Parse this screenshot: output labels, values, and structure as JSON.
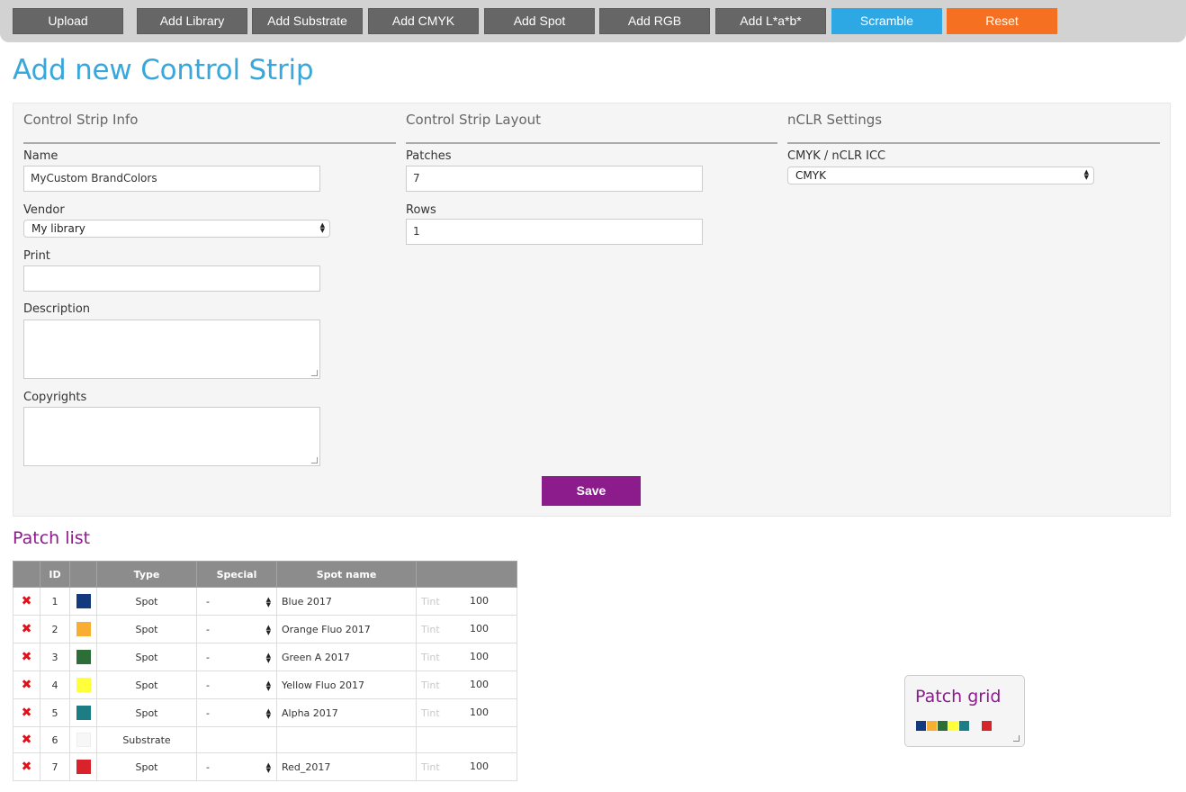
{
  "toolbar": {
    "buttons": [
      "Upload",
      "Add Library",
      "Add Substrate",
      "Add CMYK",
      "Add Spot",
      "Add RGB",
      "Add L*a*b*",
      "Scramble",
      "Reset"
    ],
    "colors": {
      "default": "#666666",
      "scramble": "#2ea8e4",
      "reset": "#f57121"
    }
  },
  "page": {
    "title": "Add new Control Strip"
  },
  "info": {
    "heading": "Control Strip Info",
    "name_label": "Name",
    "name_value": "MyCustom BrandColors",
    "vendor_label": "Vendor",
    "vendor_value": "My library",
    "print_label": "Print",
    "print_value": "",
    "description_label": "Description",
    "copyrights_label": "Copyrights"
  },
  "layout": {
    "heading": "Control Strip Layout",
    "patches_label": "Patches",
    "patches_value": "7",
    "rows_label": "Rows",
    "rows_value": "1"
  },
  "nclr": {
    "heading": "nCLR Settings",
    "icc_label": "CMYK / nCLR ICC",
    "icc_value": "CMYK"
  },
  "save_label": "Save",
  "patch_list": {
    "title": "Patch list",
    "headers": [
      "",
      "ID",
      "",
      "Type",
      "Special",
      "Spot name",
      ""
    ],
    "rows": [
      {
        "id": "1",
        "color": "#123a7c",
        "type": "Spot",
        "special": "-",
        "spot_name": "Blue 2017",
        "tint_label": "Tint",
        "tint": "100"
      },
      {
        "id": "2",
        "color": "#f7ae33",
        "type": "Spot",
        "special": "-",
        "spot_name": "Orange Fluo 2017",
        "tint_label": "Tint",
        "tint": "100"
      },
      {
        "id": "3",
        "color": "#2d6e36",
        "type": "Spot",
        "special": "-",
        "spot_name": "Green A 2017",
        "tint_label": "Tint",
        "tint": "100"
      },
      {
        "id": "4",
        "color": "#ffff3a",
        "type": "Spot",
        "special": "-",
        "spot_name": "Yellow Fluo 2017",
        "tint_label": "Tint",
        "tint": "100"
      },
      {
        "id": "5",
        "color": "#1d7d84",
        "type": "Spot",
        "special": "-",
        "spot_name": "Alpha 2017",
        "tint_label": "Tint",
        "tint": "100"
      },
      {
        "id": "6",
        "color": "#f7f7f7",
        "type": "Substrate",
        "special": "",
        "spot_name": "",
        "tint_label": "",
        "tint": ""
      },
      {
        "id": "7",
        "color": "#d9232a",
        "type": "Spot",
        "special": "-",
        "spot_name": "Red_2017",
        "tint_label": "Tint",
        "tint": "100"
      }
    ]
  },
  "patch_grid": {
    "title": "Patch grid",
    "colors": [
      "#123a7c",
      "#f7ae33",
      "#2d6e36",
      "#ffff3a",
      "#1d7d84",
      "#f5f5f5",
      "#d9232a"
    ]
  }
}
